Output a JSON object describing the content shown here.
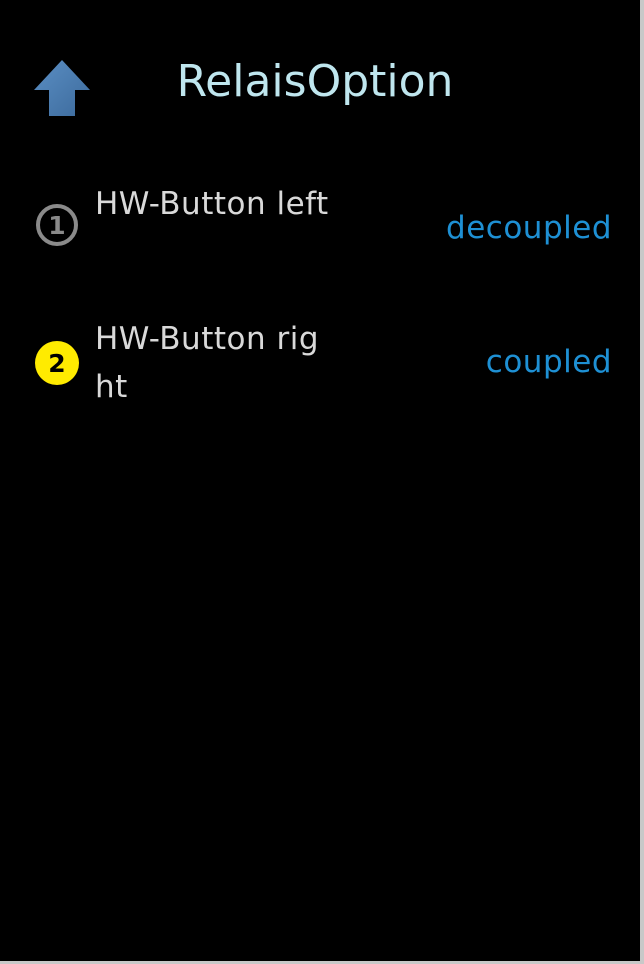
{
  "header": {
    "title": "RelaisOption",
    "back_icon": "arrow-up-icon",
    "back_icon_color": "#4a7fb5",
    "title_color": "#bfe6ee"
  },
  "options": [
    {
      "index_icon": "circled-digit-one-icon",
      "index": "1",
      "label": "HW-Button left",
      "value": "decoupled"
    },
    {
      "index_icon": "circled-digit-two-icon",
      "index": "2",
      "label": "HW-Button right",
      "value": "coupled"
    }
  ],
  "colors": {
    "background": "#000000",
    "label": "#d9d9d9",
    "value": "#1e90d4",
    "icon_inactive": "#8a8a8a",
    "icon_active": "#ffeb00"
  }
}
